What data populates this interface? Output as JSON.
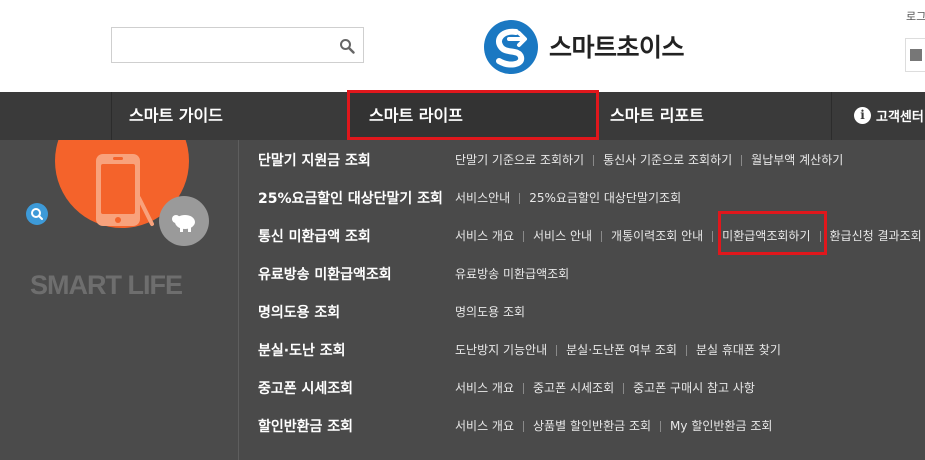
{
  "header": {
    "search": {
      "value": "",
      "placeholder": ""
    },
    "logo_text": "스마트초이스",
    "login_label": "로그"
  },
  "nav": {
    "items": [
      {
        "label": "스마트 가이드"
      },
      {
        "label": "스마트 라이프"
      },
      {
        "label": "스마트 리포트"
      },
      {
        "label": "고객센터"
      }
    ]
  },
  "left": {
    "brand": "SMART LIFE"
  },
  "menu": {
    "rows": [
      {
        "title": "단말기 지원금 조회",
        "links": [
          "단말기 기준으로 조회하기",
          "통신사 기준으로 조회하기",
          "월납부액 계산하기"
        ]
      },
      {
        "title": "25%요금할인 대상단말기 조회",
        "links": [
          "서비스안내",
          "25%요금할인 대상단말기조회"
        ]
      },
      {
        "title": "통신 미환급액 조회",
        "links": [
          "서비스 개요",
          "서비스 안내",
          "개통이력조회 안내",
          "미환급액조회하기",
          "환급신청 결과조회"
        ]
      },
      {
        "title": "유료방송 미환급액조회",
        "links": [
          "유료방송 미환급액조회"
        ]
      },
      {
        "title": "명의도용 조회",
        "links": [
          "명의도용 조회"
        ]
      },
      {
        "title": "분실·도난 조회",
        "links": [
          "도난방지 기능안내",
          "분실·도난폰 여부 조회",
          "분실 휴대폰 찾기"
        ]
      },
      {
        "title": "중고폰 시세조회",
        "links": [
          "서비스 개요",
          "중고폰 시세조회",
          "중고폰 구매시 참고 사항"
        ]
      },
      {
        "title": "할인반환금 조회",
        "links": [
          "서비스 개요",
          "상품별 할인반환금 조회",
          "My 할인반환금 조회"
        ]
      }
    ]
  },
  "colors": {
    "highlight": "#e0171c",
    "accent_orange": "#f4632b",
    "logo_blue": "#1a78c2"
  }
}
